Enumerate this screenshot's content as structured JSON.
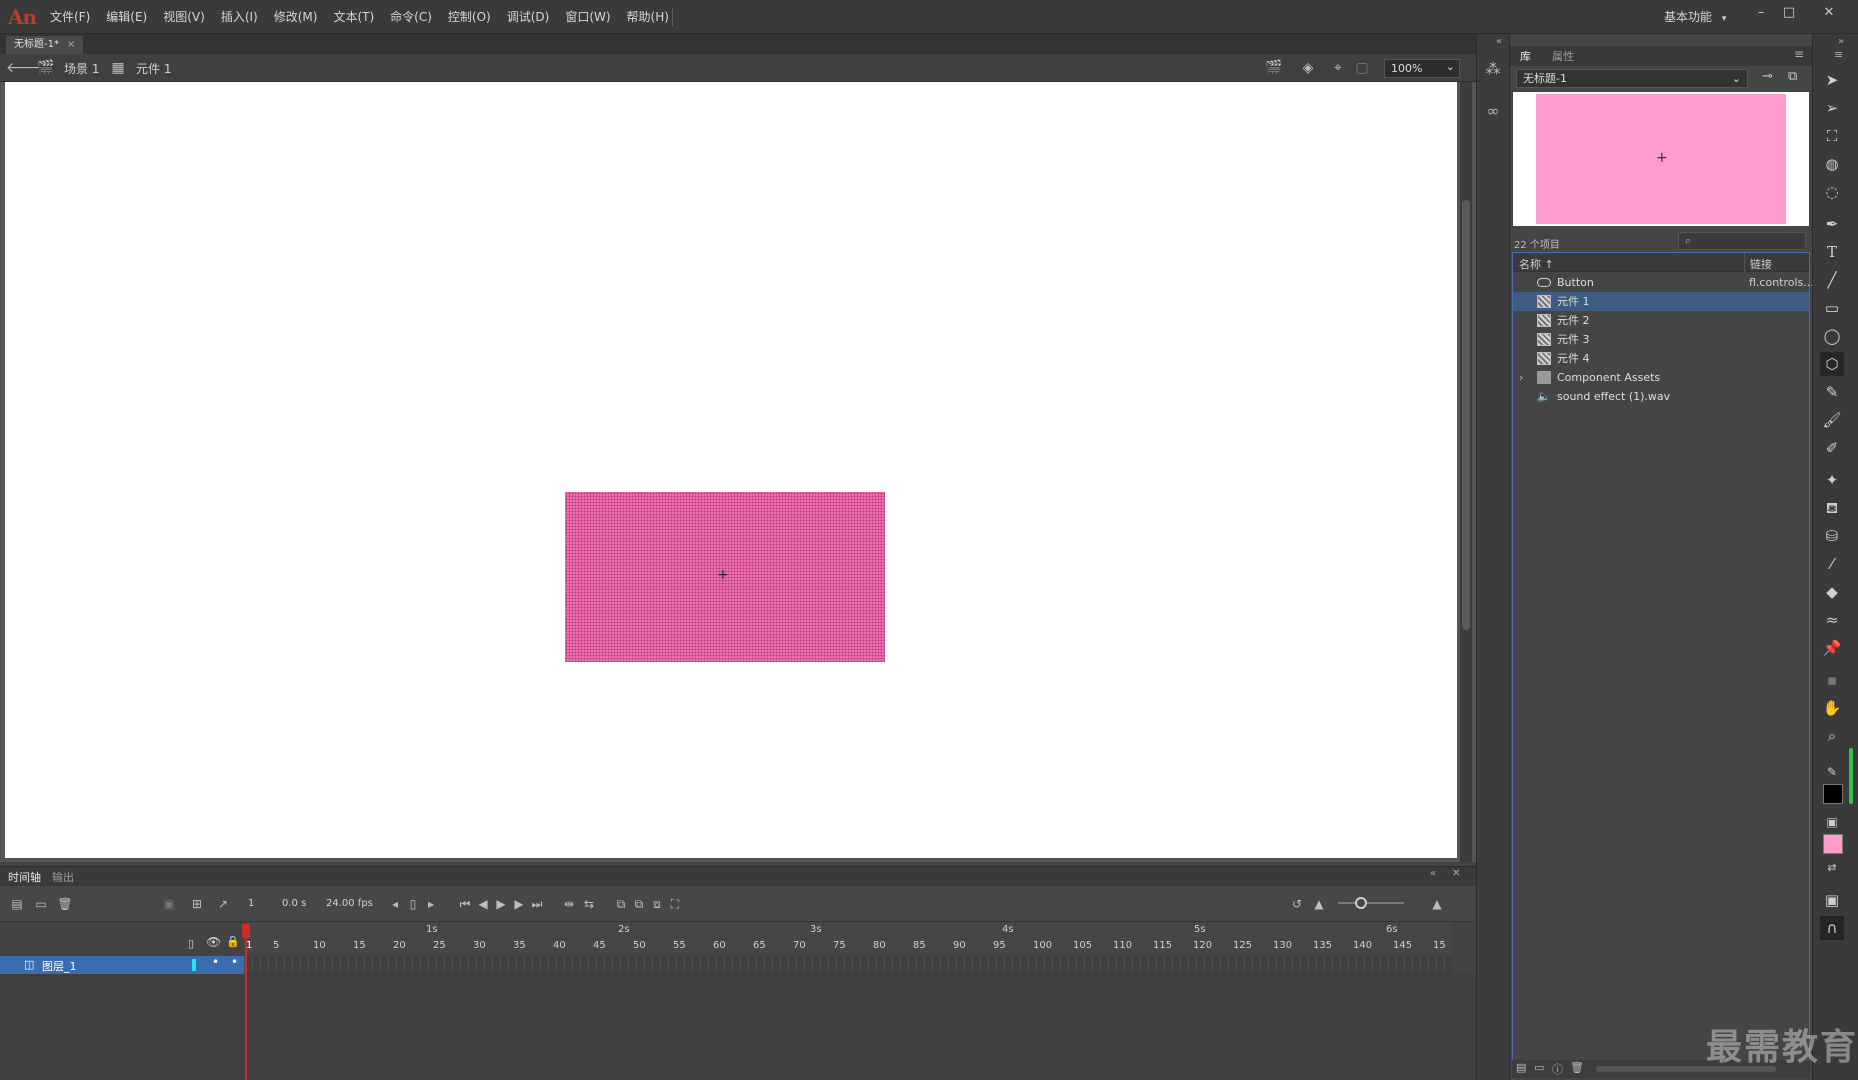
{
  "app": {
    "logo": "An"
  },
  "menu": [
    "文件(F)",
    "编辑(E)",
    "视图(V)",
    "插入(I)",
    "修改(M)",
    "文本(T)",
    "命令(C)",
    "控制(O)",
    "调试(D)",
    "窗口(W)",
    "帮助(H)"
  ],
  "workspace": {
    "label": "基本功能",
    "arrow": "▾"
  },
  "window_controls": {
    "minimize": "–",
    "maximize": "□",
    "close": "✕"
  },
  "document_tab": {
    "title": "无标题-1*",
    "close": "×"
  },
  "editbar": {
    "scene_label": "场景 1",
    "symbol_label": "元件 1",
    "zoom": "100%",
    "zoom_arrow": "⌄"
  },
  "timeline": {
    "tabs": {
      "timeline": "时间轴",
      "output": "输出"
    },
    "frame": "1",
    "time": "0.0 s",
    "fps": "24.00 fps",
    "seconds": [
      "1s",
      "2s",
      "3s",
      "4s",
      "5s",
      "6s"
    ],
    "frame_numbers": [
      "1",
      "5",
      "10",
      "15",
      "20",
      "25",
      "30",
      "35",
      "40",
      "45",
      "50",
      "55",
      "60",
      "65",
      "70",
      "75",
      "80",
      "85",
      "90",
      "95",
      "100",
      "105",
      "110",
      "115",
      "120",
      "125",
      "130",
      "135",
      "140",
      "145",
      "15"
    ],
    "layers": [
      {
        "name": "图层_1"
      }
    ]
  },
  "library": {
    "tabs": {
      "library": "库",
      "properties": "属性"
    },
    "document": "无标题-1",
    "item_count": "22 个项目",
    "search_placeholder": "",
    "columns": {
      "name": "名称 ↑",
      "linkage": "链接"
    },
    "items": [
      {
        "name": "Button",
        "linkage": "fl.controls...",
        "type": "component"
      },
      {
        "name": "元件 1",
        "linkage": "",
        "type": "movieclip",
        "selected": true
      },
      {
        "name": "元件 2",
        "linkage": "",
        "type": "movieclip"
      },
      {
        "name": "元件 3",
        "linkage": "",
        "type": "movieclip"
      },
      {
        "name": "元件 4",
        "linkage": "",
        "type": "movieclip"
      },
      {
        "name": "Component Assets",
        "linkage": "",
        "type": "folder"
      },
      {
        "name": "sound effect (1).wav",
        "linkage": "",
        "type": "sound"
      }
    ]
  },
  "colors": {
    "stroke": "#000000",
    "fill": "#ff9ccd",
    "symbol_fill": "#f06fb1",
    "selection": "#3e5b80",
    "layer_highlight": "#3a6db0",
    "playhead": "#d02b2b"
  },
  "watermark": "最需教育"
}
